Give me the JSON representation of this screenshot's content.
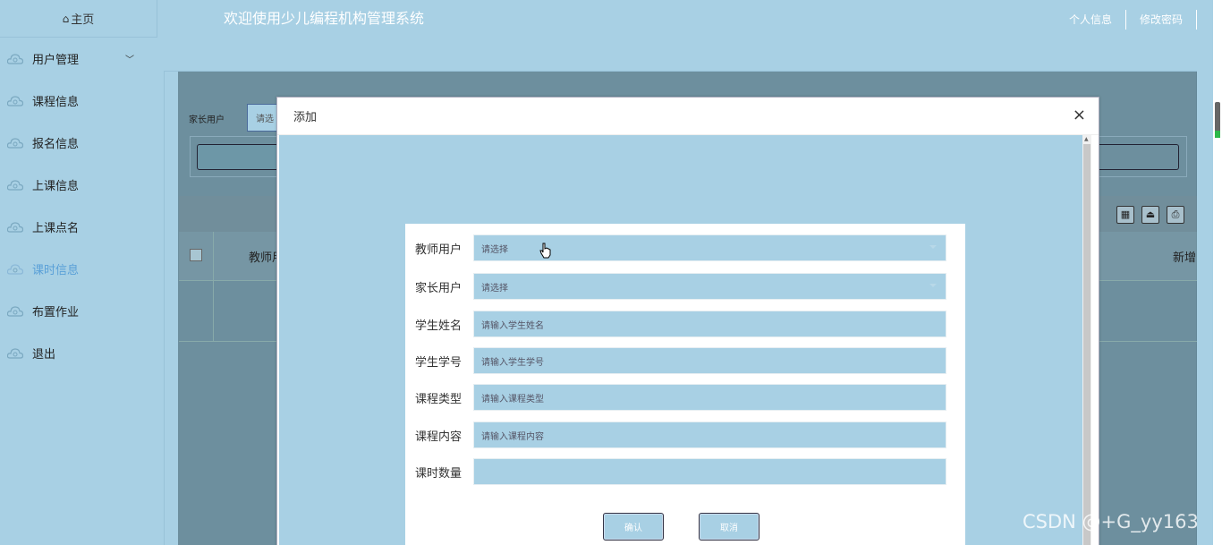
{
  "sidebar": {
    "home_label": "主页",
    "items": [
      {
        "label": "用户管理",
        "has_chevron": true
      },
      {
        "label": "课程信息"
      },
      {
        "label": "报名信息"
      },
      {
        "label": "上课信息"
      },
      {
        "label": "上课点名"
      },
      {
        "label": "课时信息",
        "active": true
      },
      {
        "label": "布置作业"
      },
      {
        "label": "退出"
      }
    ]
  },
  "header": {
    "title": "欢迎使用少儿编程机构管理系统",
    "links": [
      "个人信息",
      "修改密码"
    ]
  },
  "background": {
    "search_label": "家长用户",
    "search_placeholder": "请选",
    "table_header_col1": "教师用",
    "table_header_right": "新增"
  },
  "modal": {
    "title": "添加",
    "close": "×",
    "fields": [
      {
        "label": "教师用户",
        "placeholder": "请选择",
        "type": "select"
      },
      {
        "label": "家长用户",
        "placeholder": "请选择",
        "type": "select"
      },
      {
        "label": "学生姓名",
        "placeholder": "请输入学生姓名",
        "type": "text"
      },
      {
        "label": "学生学号",
        "placeholder": "请输入学生学号",
        "type": "text"
      },
      {
        "label": "课程类型",
        "placeholder": "请输入课程类型",
        "type": "text"
      },
      {
        "label": "课程内容",
        "placeholder": "请输入课程内容",
        "type": "text"
      },
      {
        "label": "课时数量",
        "placeholder": "",
        "type": "text"
      }
    ],
    "confirm_label": "确认",
    "cancel_label": "取消"
  },
  "watermark": "CSDN @+G_yy163",
  "colors": {
    "background": "#a8d0e4",
    "active_menu": "#5aa0d8"
  }
}
